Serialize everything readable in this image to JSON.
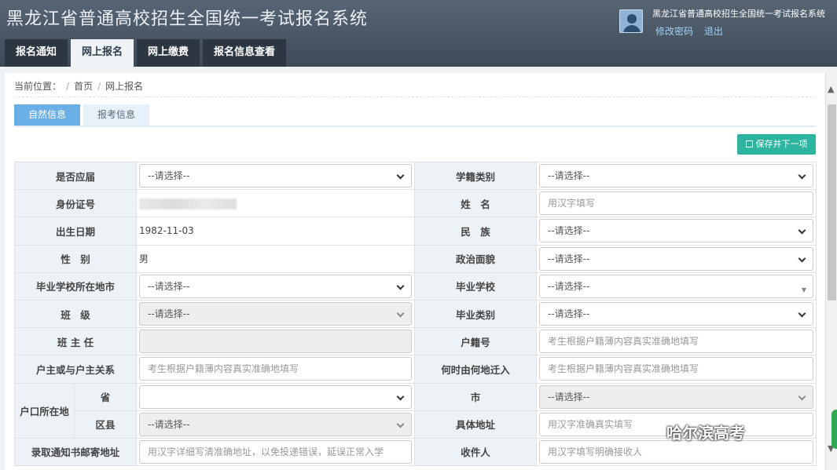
{
  "header": {
    "title": "黑龙江省普通高校招生全国统一考试报名系统",
    "user_name": "黑龙江省普通高校招生全国统一考试报名系统",
    "change_password": "修改密码",
    "logout": "退出"
  },
  "nav": {
    "tabs": [
      "报名通知",
      "网上报名",
      "网上缴费",
      "报名信息查看"
    ],
    "active_index": 1
  },
  "breadcrumb": {
    "prefix": "当前位置：",
    "items": [
      "首页",
      "网上报名"
    ]
  },
  "subtabs": {
    "items": [
      "自然信息",
      "报考信息"
    ],
    "active_index": 0
  },
  "save_button": "保存并下一项",
  "form": {
    "select_default": "--请选择--",
    "is_current_grad": "是否应届",
    "student_status_type": "学籍类别",
    "id_number": "身份证号",
    "name": "姓　名",
    "name_placeholder": "用汉字填写",
    "birth_date": "出生日期",
    "birth_date_value": "1982-11-03",
    "ethnicity": "民　族",
    "gender": "性　别",
    "gender_value": "男",
    "political_status": "政治面貌",
    "grad_school_city": "毕业学校所在地市",
    "grad_school": "毕业学校",
    "class": "班　级",
    "grad_type": "毕业类别",
    "head_teacher": "班 主 任",
    "household_no": "户籍号",
    "household_no_placeholder": "考生根据户籍薄内容真实准确地填写",
    "relation_to_head": "户主或与户主关系",
    "relation_placeholder": "考生根据户籍薄内容真实准确地填写",
    "moved_in": "何时由何地迁入",
    "moved_in_placeholder": "考生根据户籍薄内容真实准确地填写",
    "household_location": "户口所在地",
    "province": "省",
    "city": "市",
    "district": "区县",
    "address": "具体地址",
    "address_placeholder": "用汉字准确真实填写",
    "mailing_address": "录取通知书邮寄地址",
    "mailing_placeholder": "用汉字详细写清准确地址，以免投递错误，延误正常入学",
    "recipient": "收件人",
    "recipient_placeholder": "用汉字填写明确接收人"
  },
  "watermark": "哈尔滨高考"
}
